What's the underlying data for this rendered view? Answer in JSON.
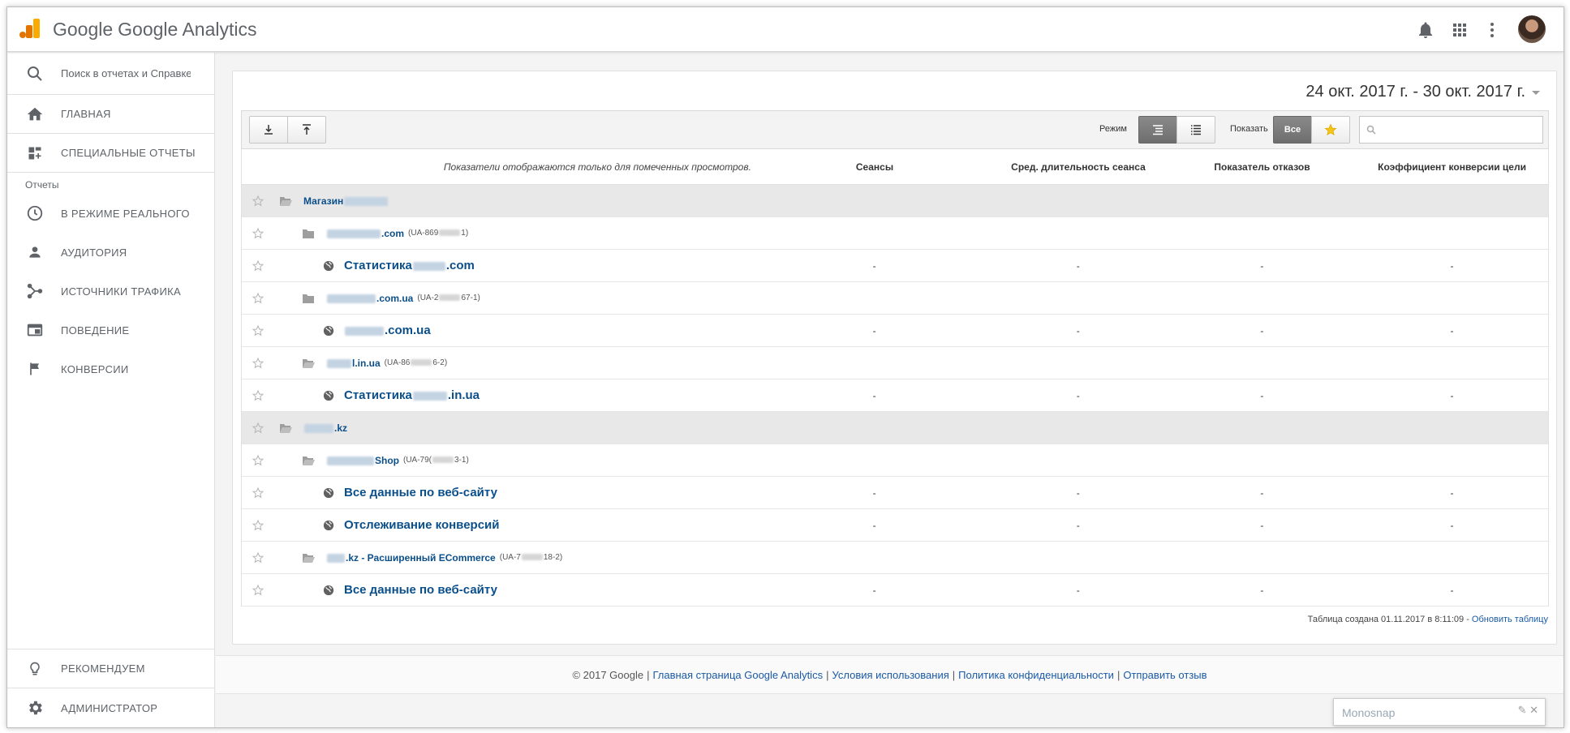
{
  "app": {
    "google_word": "Google",
    "product_name": "Google Analytics",
    "accent_colors": [
      "#F9AB00",
      "#E37400"
    ]
  },
  "header": {
    "icons": [
      "bell-icon",
      "apps-grid-icon",
      "more-vert-icon",
      "avatar"
    ]
  },
  "sidebar": {
    "search_placeholder": "Поиск в отчетах и Справке",
    "home": "Главная",
    "custom_reports": "Специальные отчеты",
    "reports_label": "Отчеты",
    "realtime": "В режиме реального",
    "audience": "Аудитория",
    "acquisition": "Источники трафика",
    "behavior": "Поведение",
    "conversions": "Конверсии",
    "recommend": "Рекомендуем",
    "admin": "Администратор"
  },
  "date_range": "24 окт. 2017 г. - 30 окт. 2017 г.",
  "toolbar": {
    "mode_label": "Режим",
    "show_label": "Показать",
    "show_all": "Все"
  },
  "table": {
    "note": "Показатели отображаются только для помеченных просмотров.",
    "columns": [
      "Сеансы",
      "Сред. длительность сеанса",
      "Показатель отказов",
      "Коэффициент конверсии цели"
    ],
    "rows": [
      {
        "level": 0,
        "name": "Магазин",
        "suffix": "",
        "ua": ""
      },
      {
        "level": 1,
        "name": "",
        "suffix": ".com",
        "ua": "(UA-869",
        "ua_end": "1)"
      },
      {
        "level": 2,
        "name": "Статистика",
        "suffix": ".com",
        "values": [
          "-",
          "-",
          "-",
          "-"
        ]
      },
      {
        "level": 1,
        "name": "",
        "suffix": ".com.ua",
        "ua": "(UA-2",
        "ua_end": "67-1)"
      },
      {
        "level": 2,
        "name": "",
        "suffix": ".com.ua",
        "values": [
          "-",
          "-",
          "-",
          "-"
        ]
      },
      {
        "level": 1,
        "name": "",
        "suffix": "l.in.ua",
        "ua": "(UA-86",
        "ua_end": "6-2)"
      },
      {
        "level": 2,
        "name": "Статистика",
        "suffix": ".in.ua",
        "values": [
          "-",
          "-",
          "-",
          "-"
        ]
      },
      {
        "level": 0,
        "name": "",
        "suffix": ".kz",
        "ua": ""
      },
      {
        "level": 1,
        "name": "",
        "suffix": "Shop",
        "ua": "(UA-79(",
        "ua_end": "3-1)"
      },
      {
        "level": 2,
        "name": "Все данные по веб-сайту",
        "suffix": "",
        "values": [
          "-",
          "-",
          "-",
          "-"
        ]
      },
      {
        "level": 2,
        "name": "Отслеживание конверсий",
        "suffix": "",
        "values": [
          "-",
          "-",
          "-",
          "-"
        ]
      },
      {
        "level": 1,
        "name": "",
        "suffix": ".kz - Расширенный ECommerce",
        "ua": "(UA-7",
        "ua_end": "18-2)"
      },
      {
        "level": 2,
        "name": "Все данные по веб-сайту",
        "suffix": "",
        "values": [
          "-",
          "-",
          "-",
          "-"
        ]
      }
    ],
    "footer_text": "Таблица создана 01.11.2017 в 8:11:09 - ",
    "refresh_link": "Обновить таблицу"
  },
  "footer": {
    "copyright": "© 2017 Google",
    "links": [
      "Главная страница Google Analytics",
      "Условия использования",
      "Политика конфиденциальности",
      "Отправить отзыв"
    ]
  },
  "monosnap": {
    "title": "Monosnap"
  }
}
